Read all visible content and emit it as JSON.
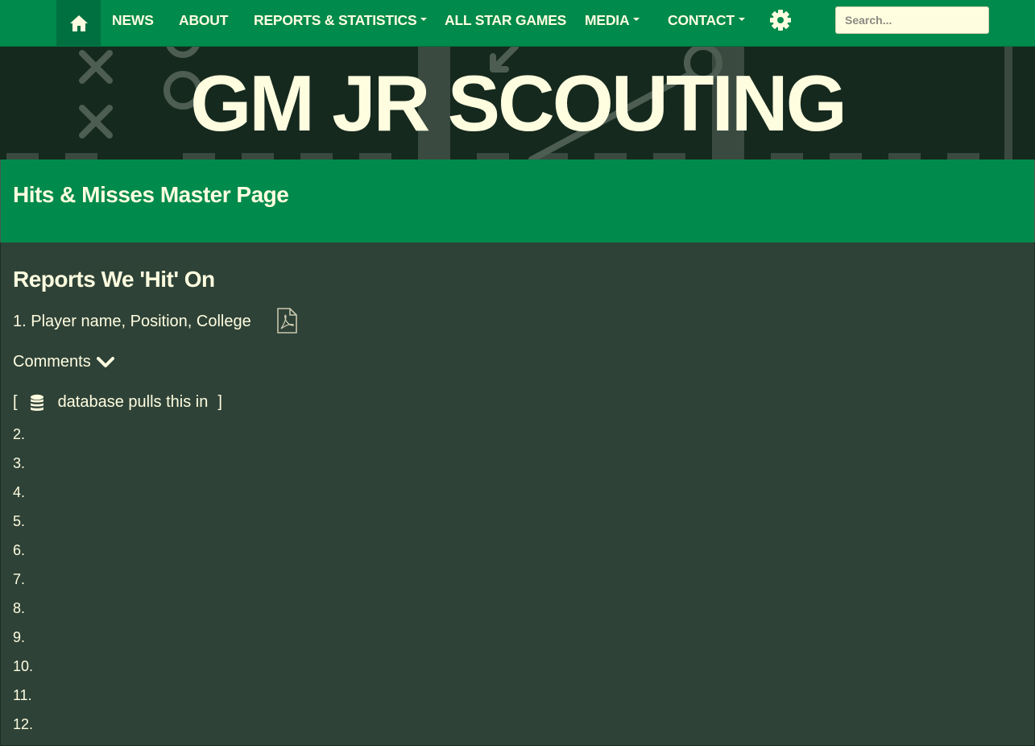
{
  "nav": {
    "home_icon": "home-icon",
    "items": [
      {
        "label": "NEWS",
        "dropdown": false
      },
      {
        "label": "ABOUT",
        "dropdown": false
      },
      {
        "label": "REPORTS & STATISTICS",
        "dropdown": true
      },
      {
        "label": "ALL STAR GAMES",
        "dropdown": false
      },
      {
        "label": "MEDIA",
        "dropdown": true
      },
      {
        "label": "CONTACT",
        "dropdown": true
      }
    ],
    "settings_icon": "gear-icon",
    "search_placeholder": "Search..."
  },
  "banner": {
    "site_title": "GM JR SCOUTING"
  },
  "page": {
    "title": "Hits & Misses Master Page"
  },
  "section": {
    "title": "Reports We 'Hit' On",
    "first_entry": "1. Player name, Position, College",
    "pdf_icon": "pdf-file-icon",
    "comments_label": "Comments",
    "comments_icon": "chevron-down-icon",
    "db_open": "[",
    "db_icon": "database-icon",
    "db_text": "database pulls this in",
    "db_close": "]",
    "numbers": [
      "2.",
      "3.",
      "4.",
      "5.",
      "6.",
      "7.",
      "8.",
      "9.",
      "10.",
      "11.",
      "12."
    ]
  },
  "colors": {
    "nav_green": "#008a4c",
    "home_active": "#017040",
    "banner_bg": "#16291e",
    "content_bg": "#2e4237",
    "text_cream": "#fffde0"
  }
}
